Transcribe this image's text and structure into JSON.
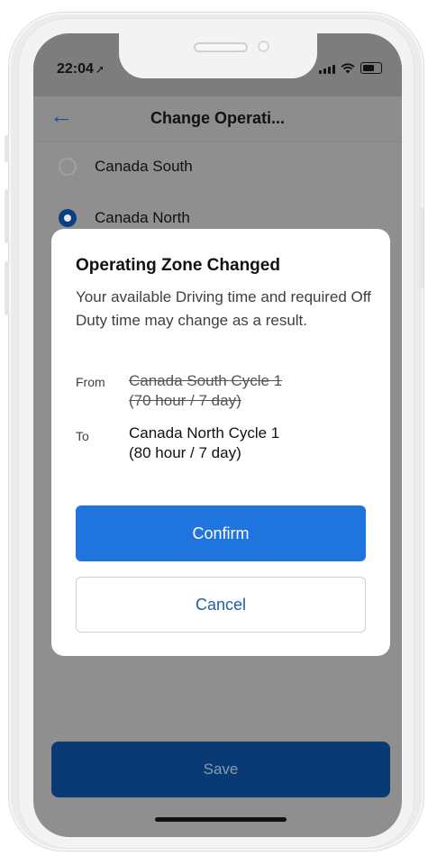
{
  "status_bar": {
    "time": "22:04",
    "location_glyph": "➚"
  },
  "nav": {
    "back_glyph": "←",
    "title": "Change Operati..."
  },
  "options": [
    {
      "label": "Canada South",
      "selected": false
    },
    {
      "label": "Canada North",
      "selected": true
    }
  ],
  "dialog": {
    "title": "Operating Zone Changed",
    "body": "Your available Driving time and required Off Duty time may change as a result.",
    "from_label": "From",
    "from_value_line1": "Canada South Cycle 1",
    "from_value_line2": "(70 hour / 7 day)",
    "to_label": "To",
    "to_value_line1": "Canada North Cycle 1",
    "to_value_line2": "(80 hour / 7 day)",
    "confirm_label": "Confirm",
    "cancel_label": "Cancel"
  },
  "footer": {
    "save_label": "Save"
  },
  "colors": {
    "primary": "#2074dd",
    "selected_radio": "#0a3f83",
    "save_bg": "#0a3a73"
  },
  "icons": [
    "location-arrow-icon",
    "back-arrow-icon",
    "signal-icon",
    "wifi-icon",
    "battery-icon"
  ]
}
